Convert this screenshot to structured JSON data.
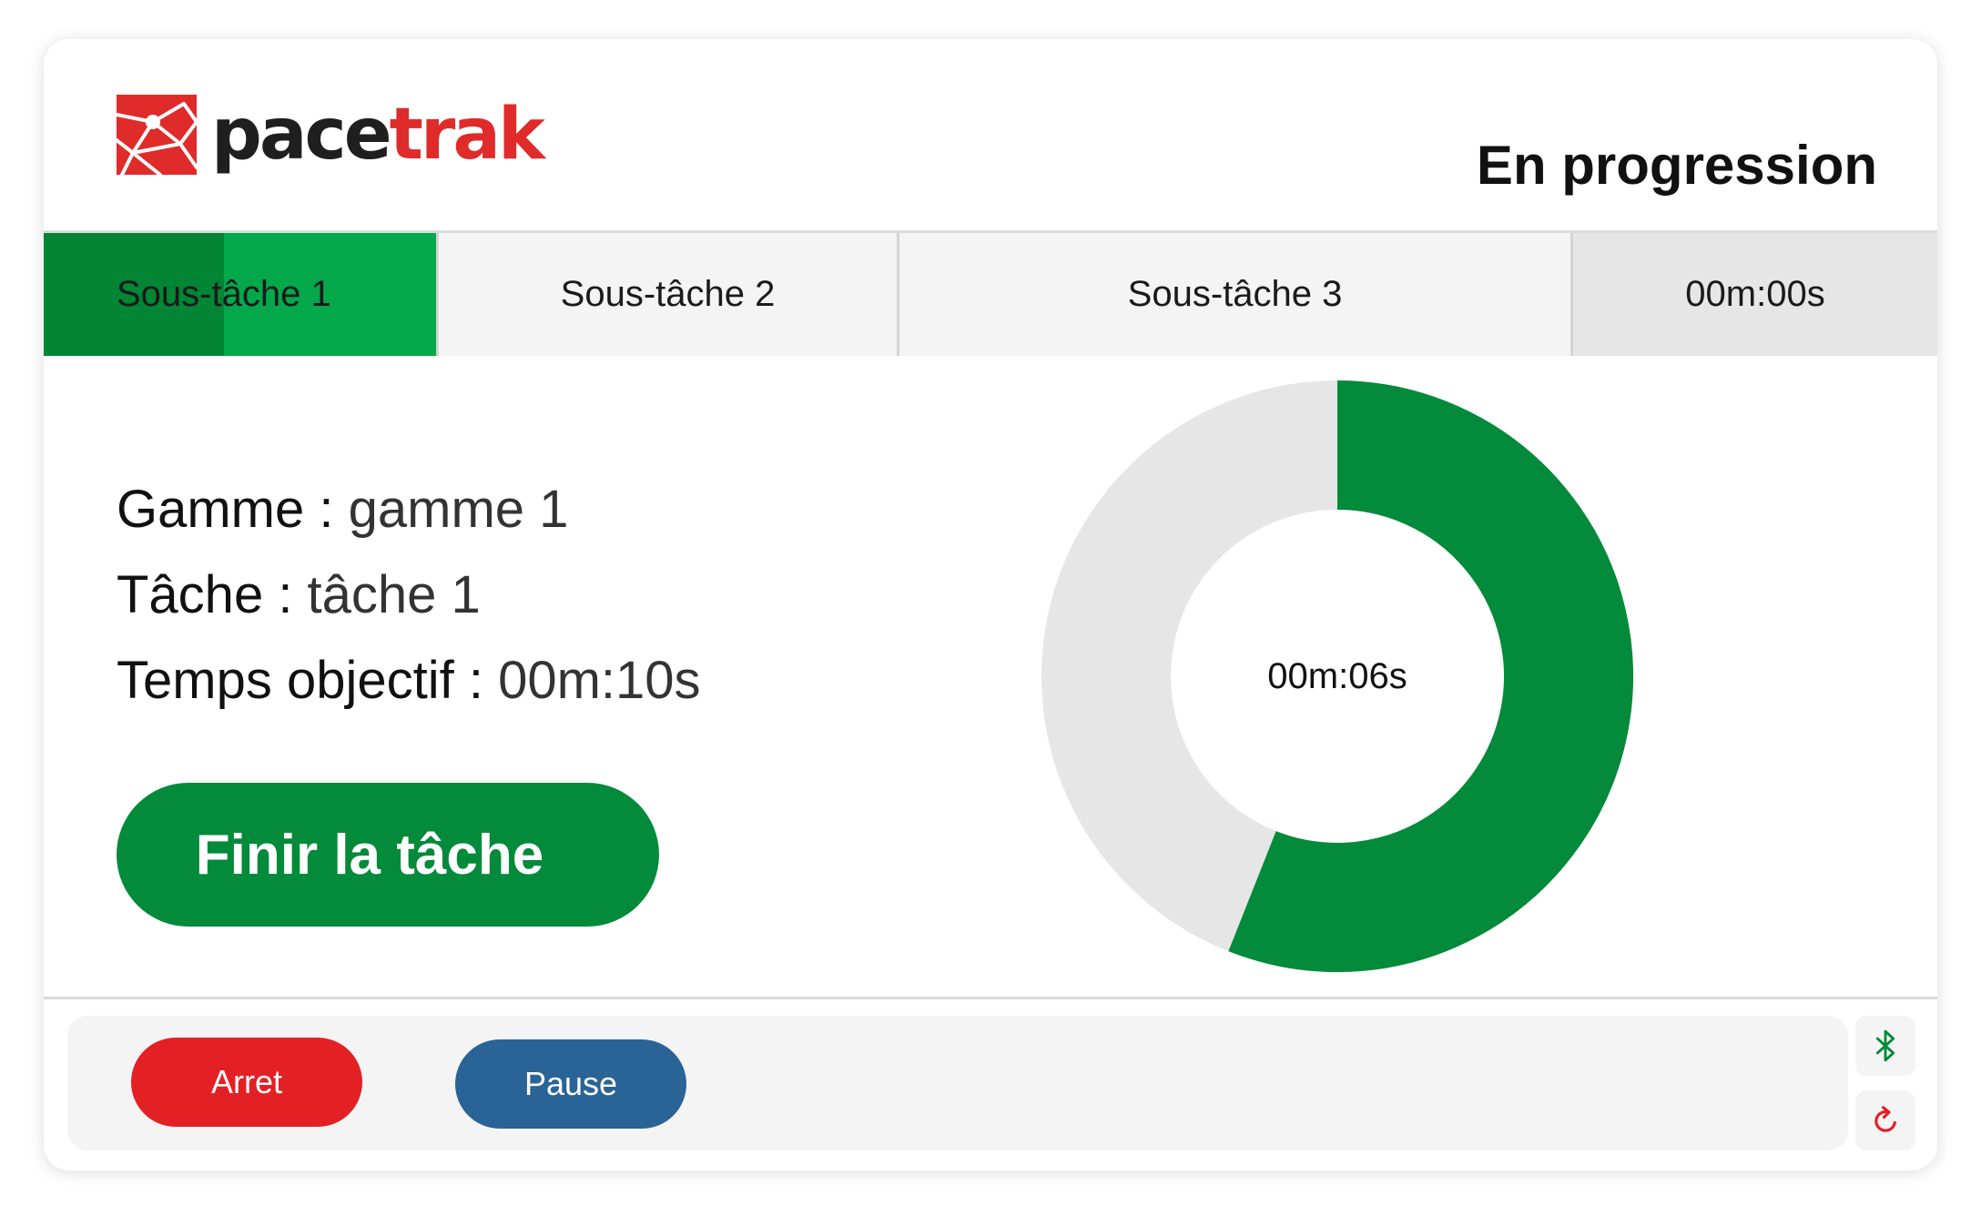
{
  "header": {
    "logo_part1": "pace",
    "logo_part2": "trak",
    "status": "En progression"
  },
  "tabs": [
    {
      "label": "Sous-tâche 1",
      "active": true,
      "progress_percent": 46
    },
    {
      "label": "Sous-tâche 2"
    },
    {
      "label": "Sous-tâche 3"
    }
  ],
  "tab_timer": "00m:00s",
  "info": {
    "gamme_label": "Gamme : ",
    "gamme_value": "gamme 1",
    "tache_label": "Tâche : ",
    "tache_value": "tâche 1",
    "objectif_label": "Temps objectif : ",
    "objectif_value": "00m:10s"
  },
  "finish_button": "Finir la tâche",
  "donut": {
    "center_label": "00m:06s",
    "progress_fraction": 0.56,
    "fill_color": "#038a3a",
    "track_color": "#e6e6e6"
  },
  "controls": {
    "stop_label": "Arret",
    "pause_label": "Pause"
  },
  "colors": {
    "brand_red": "#e02b2b",
    "green": "#038a3a",
    "stop_red": "#e32024",
    "pause_blue": "#2a6396"
  },
  "icons": {
    "bluetooth": "bluetooth-icon",
    "refresh": "refresh-icon"
  }
}
